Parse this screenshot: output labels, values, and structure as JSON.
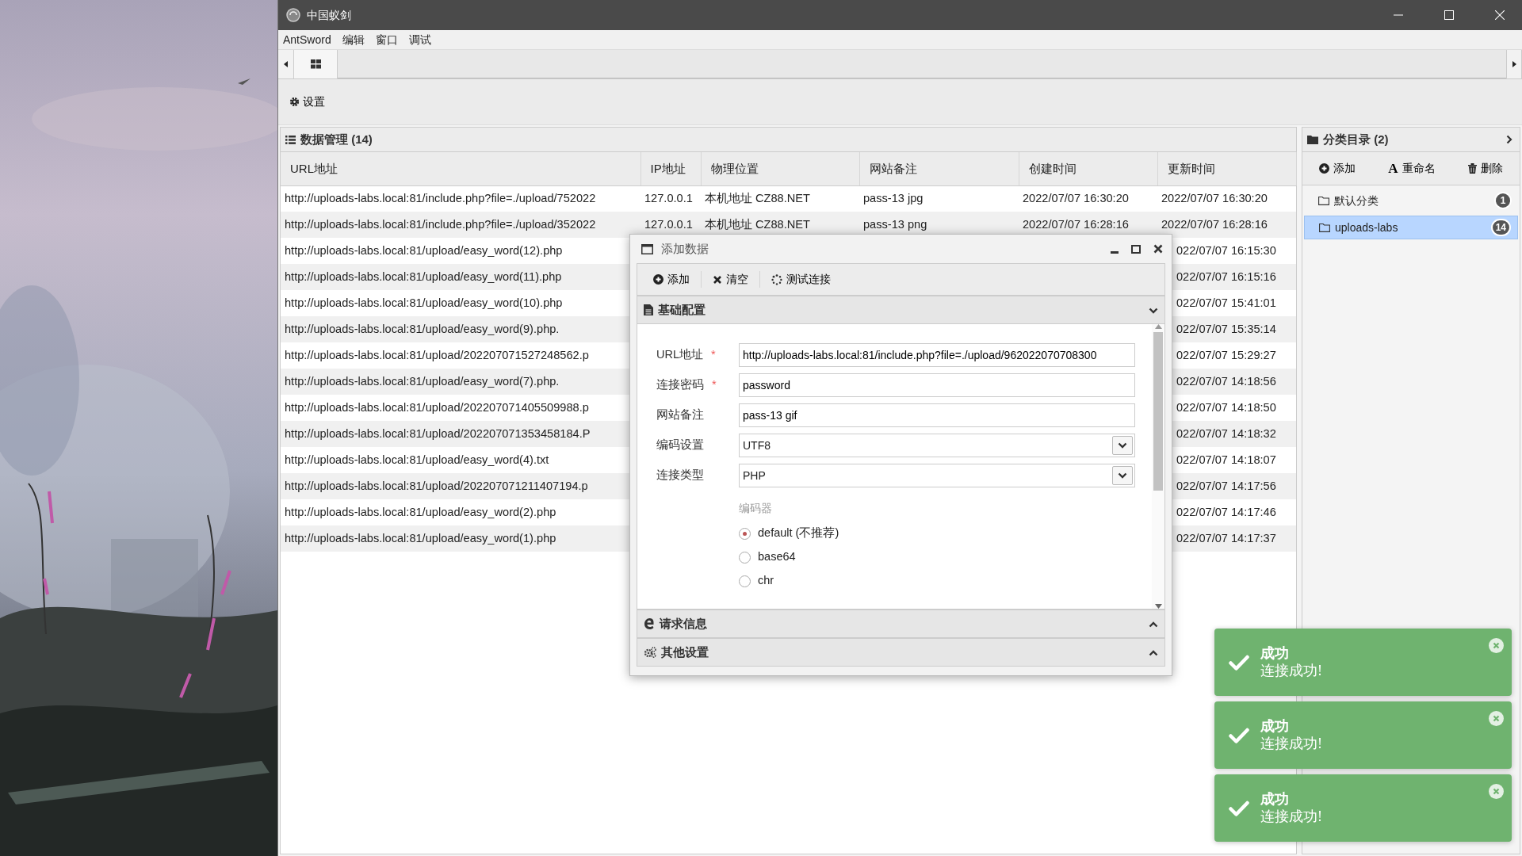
{
  "window": {
    "title": "中国蚁剑"
  },
  "menu": [
    "AntSword",
    "编辑",
    "窗口",
    "调试"
  ],
  "tabs": [
    {
      "selected": true
    }
  ],
  "toolbar": [
    {
      "label": "设置"
    }
  ],
  "data_panel": {
    "title": "数据管理 (14)",
    "columns": [
      "URL地址",
      "IP地址",
      "物理位置",
      "网站备注",
      "创建时间",
      "更新时间"
    ],
    "rows": [
      {
        "url": "http://uploads-labs.local:81/include.php?file=./upload/752022",
        "ip": "127.0.0.1",
        "location": "本机地址 CZ88.NET",
        "note": "pass-13 jpg",
        "created": "2022/07/07 16:30:20",
        "updated": "2022/07/07 16:30:20"
      },
      {
        "url": "http://uploads-labs.local:81/include.php?file=./upload/352022",
        "ip": "127.0.0.1",
        "location": "本机地址 CZ88.NET",
        "note": "pass-13 png",
        "created": "2022/07/07 16:28:16",
        "updated": "2022/07/07 16:28:16"
      },
      {
        "url": "http://uploads-labs.local:81/upload/easy_word(12).php",
        "updated": "022/07/07 16:15:30"
      },
      {
        "url": "http://uploads-labs.local:81/upload/easy_word(11).php",
        "updated": "022/07/07 16:15:16"
      },
      {
        "url": "http://uploads-labs.local:81/upload/easy_word(10).php",
        "updated": "022/07/07 15:41:01"
      },
      {
        "url": "http://uploads-labs.local:81/upload/easy_word(9).php.",
        "updated": "022/07/07 15:35:14"
      },
      {
        "url": "http://uploads-labs.local:81/upload/202207071527248562.p",
        "updated": "022/07/07 15:29:27"
      },
      {
        "url": "http://uploads-labs.local:81/upload/easy_word(7).php.",
        "updated": "022/07/07 14:18:56"
      },
      {
        "url": "http://uploads-labs.local:81/upload/202207071405509988.p",
        "updated": "022/07/07 14:18:50"
      },
      {
        "url": "http://uploads-labs.local:81/upload/202207071353458184.P",
        "updated": "022/07/07 14:18:32"
      },
      {
        "url": "http://uploads-labs.local:81/upload/easy_word(4).txt",
        "updated": "022/07/07 14:18:07"
      },
      {
        "url": "http://uploads-labs.local:81/upload/202207071211407194.p",
        "updated": "022/07/07 14:17:56"
      },
      {
        "url": "http://uploads-labs.local:81/upload/easy_word(2).php",
        "updated": "022/07/07 14:17:46"
      },
      {
        "url": "http://uploads-labs.local:81/upload/easy_word(1).php",
        "updated": "022/07/07 14:17:37"
      }
    ]
  },
  "category_panel": {
    "title": "分类目录 (2)",
    "buttons": [
      {
        "kind": "add",
        "label": "添加"
      },
      {
        "kind": "rename",
        "glyph": "A",
        "label": "重命名"
      },
      {
        "kind": "delete",
        "label": "删除"
      }
    ],
    "items": [
      {
        "name": "默认分类",
        "count": "1",
        "selected": false
      },
      {
        "name": "uploads-labs",
        "count": "14",
        "selected": true
      }
    ]
  },
  "dialog": {
    "title": "添加数据",
    "buttons": [
      {
        "kind": "add",
        "label": "添加"
      },
      {
        "kind": "clear",
        "label": "清空"
      },
      {
        "kind": "test",
        "label": "测试连接"
      }
    ],
    "sections": [
      {
        "kind": "doc",
        "title": "基础配置",
        "expanded": true
      },
      {
        "kind": "request",
        "title": "请求信息",
        "expanded": false
      },
      {
        "kind": "gears",
        "title": "其他设置",
        "expanded": false
      }
    ],
    "fields": [
      {
        "kind": "text",
        "label": "URL地址",
        "mark": "*",
        "value": "http://uploads-labs.local:81/include.php?file=./upload/962022070708300"
      },
      {
        "kind": "text",
        "label": "连接密码",
        "mark": "*",
        "value": "password"
      },
      {
        "kind": "text",
        "label": "网站备注",
        "value": "pass-13 gif"
      },
      {
        "kind": "select",
        "label": "编码设置",
        "value": "UTF8"
      },
      {
        "kind": "select",
        "label": "连接类型",
        "value": "PHP"
      }
    ],
    "encoder": {
      "label": "编码器",
      "options": [
        {
          "label": "default (不推荐)",
          "selected": true
        },
        {
          "label": "base64",
          "selected": false
        },
        {
          "label": "chr",
          "selected": false
        }
      ]
    }
  },
  "notifications": [
    {
      "title": "成功",
      "message": "连接成功!"
    },
    {
      "title": "成功",
      "message": "连接成功!"
    },
    {
      "title": "成功",
      "message": "连接成功!"
    }
  ]
}
